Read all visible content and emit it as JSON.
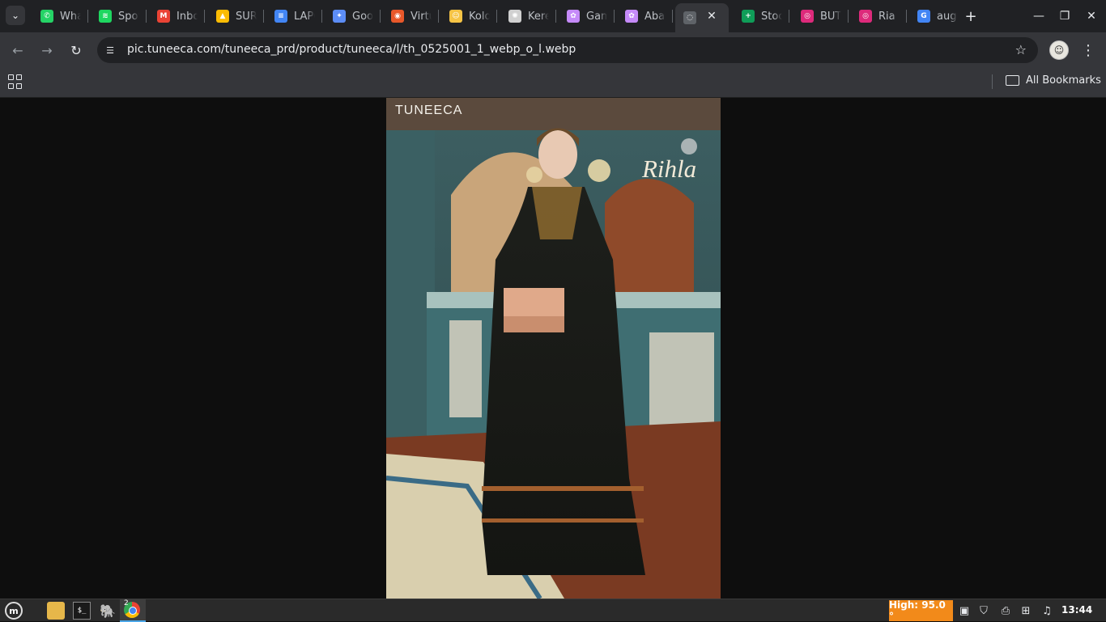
{
  "tabs": [
    {
      "title": "WhatsApp",
      "icon": "whatsapp-icon",
      "color": "#25d366",
      "glyph": "✆"
    },
    {
      "title": "Spotify",
      "icon": "spotify-icon",
      "color": "#1ed760",
      "glyph": "≋"
    },
    {
      "title": "Inbox",
      "icon": "gmail-icon",
      "color": "#ea4335",
      "glyph": "M"
    },
    {
      "title": "SURAT",
      "icon": "drive-icon",
      "color": "#fbbc04",
      "glyph": "▲"
    },
    {
      "title": "LAPORAN",
      "icon": "docs-icon",
      "color": "#4285f4",
      "glyph": "≡"
    },
    {
      "title": "Google",
      "icon": "gemini-icon",
      "color": "#5c8df6",
      "glyph": "✦"
    },
    {
      "title": "Virtual",
      "icon": "virtual-icon",
      "color": "#e8582a",
      "glyph": "◉"
    },
    {
      "title": "Kolom",
      "icon": "emoji-icon",
      "color": "#f6c445",
      "glyph": "☺"
    },
    {
      "title": "Kerenn",
      "icon": "openai-icon",
      "color": "#d0d0d0",
      "glyph": "✺"
    },
    {
      "title": "Gamis",
      "icon": "flower-icon",
      "color": "#c58af9",
      "glyph": "✿"
    },
    {
      "title": "Abaya",
      "icon": "flower-icon",
      "color": "#c58af9",
      "glyph": "✿"
    },
    {
      "title": "",
      "icon": "globe-icon",
      "color": "#5f6368",
      "glyph": "◌"
    },
    {
      "title": "Stock",
      "icon": "sheets-icon",
      "color": "#0f9d58",
      "glyph": "+"
    },
    {
      "title": "BUTIK",
      "icon": "instagram-icon",
      "color": "#dd2a7b",
      "glyph": "◎"
    },
    {
      "title": "Ria R",
      "icon": "instagram-icon",
      "color": "#dd2a7b",
      "glyph": "◎"
    },
    {
      "title": "august",
      "icon": "google-icon",
      "color": "#4285f4",
      "glyph": "G"
    }
  ],
  "toolbar": {
    "url": "pic.tuneeca.com/tuneeca_prd/product/tuneeca/l/th_0525001_1_webp_o_l.webp"
  },
  "bookmarks": {
    "all_label": "All Bookmarks"
  },
  "image": {
    "brand": "TUNEECA",
    "collection": "Rihla"
  },
  "taskbar": {
    "temperature": "High: 95.0 °",
    "time": "13:44",
    "chrome_count": "2"
  }
}
